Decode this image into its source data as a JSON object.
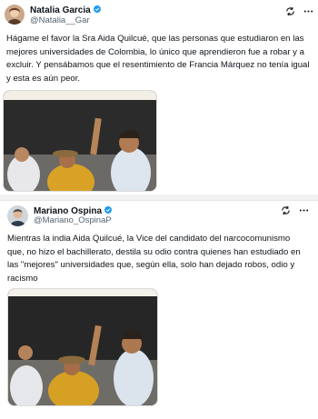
{
  "tweets": [
    {
      "name": "Natalia Garcia",
      "handle": "@Natalia__Gar",
      "text": "Hágame el favor la Sra Aida Quilcué, que las personas que estudiaron en las mejores universidades de Colombia, lo único que aprendieron fue a robar y a excluir. Y pensábamos que el resentimiento de Francia Márquez no tenía igual y esta es aún peor."
    },
    {
      "name": "Mariano Ospina",
      "handle": "@Mariano_OspinaP",
      "text": "Mientras la india Aida Quilcué, la Vice del candidato del narcocomunismo que, no hizo el bachillerato, destila su odio contra quienes han estudiado en las \"mejores\" universidades que, según ella, solo han dejado robos, odio y racismo"
    }
  ],
  "icons": {
    "verified": "verified-badge-icon",
    "grok": "grok-icon",
    "more": "more-options-icon"
  },
  "colors": {
    "verified": "#1d9bf0",
    "text": "#0f1419",
    "muted": "#536471"
  }
}
